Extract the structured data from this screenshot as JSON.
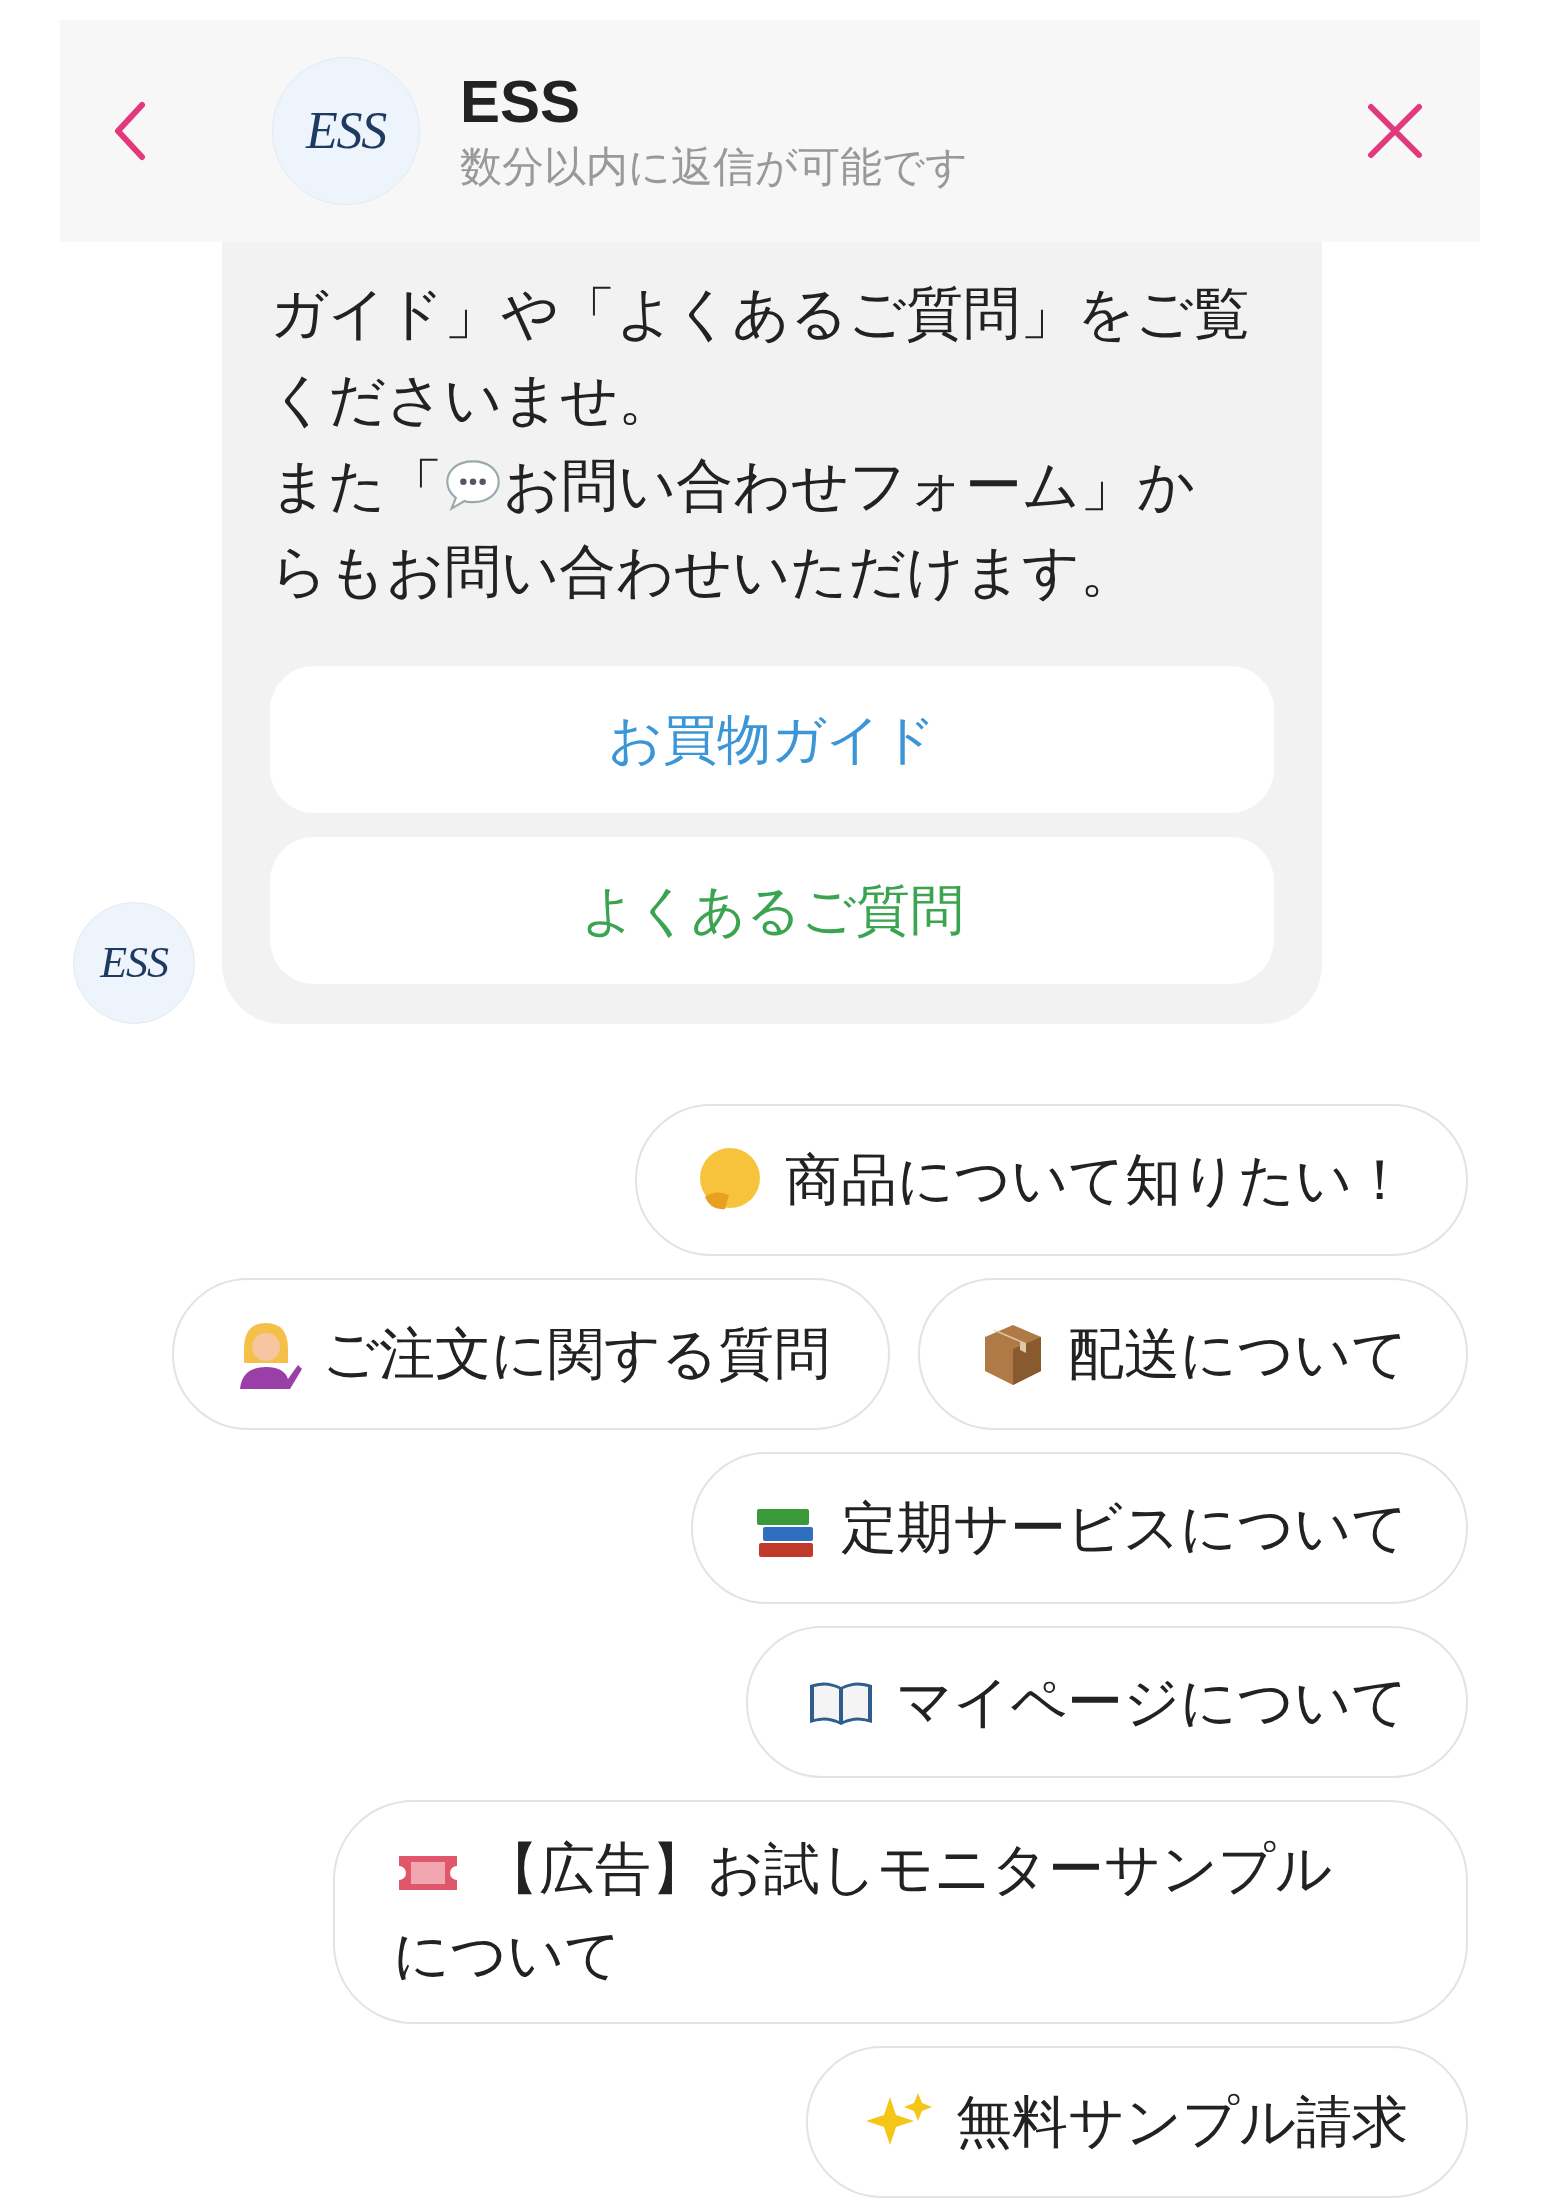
{
  "header": {
    "title": "ESS",
    "avatar": "ESS",
    "subtitle": "数分以内に返信が可能です"
  },
  "message": {
    "avatar": "ESS",
    "lines": [
      "ガイド」や「よくあるご質問」をご覧くださいませ。"
    ],
    "line2_before": "また「",
    "line2_after": "お問い合わせフォーム」か",
    "line3": "らもお問い合わせいただけます。",
    "buttons": [
      {
        "label": "お買物ガイド",
        "color": "#3a96d6"
      },
      {
        "label": "よくあるご質問",
        "color": "#3ba450"
      }
    ]
  },
  "quick_replies": [
    {
      "kind": "thinking",
      "label": "商品について知りたい！"
    },
    {
      "kind": "person",
      "label": "ご注文に関する質問"
    },
    {
      "kind": "package",
      "label": "配送について"
    },
    {
      "kind": "books",
      "label": "定期サービスについて"
    },
    {
      "kind": "book",
      "label": "マイページについて"
    },
    {
      "kind": "ticket",
      "label": "【広告】お試しモニターサンプルについて"
    },
    {
      "kind": "sparkles",
      "label": "無料サンプル請求"
    }
  ]
}
